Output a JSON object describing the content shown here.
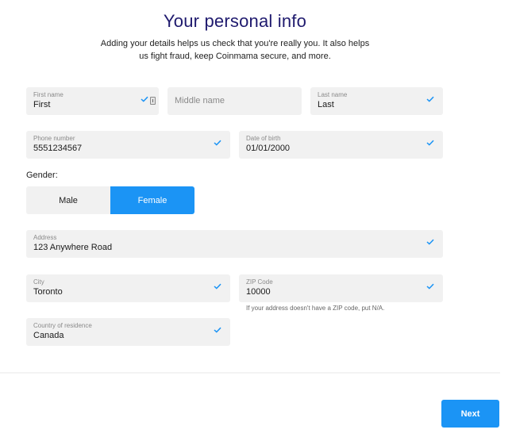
{
  "header": {
    "title": "Your personal info",
    "subtitle": "Adding your details helps us check that you're really you. It also helps us fight fraud, keep Coinmama secure, and more."
  },
  "fields": {
    "first_name": {
      "label": "First name",
      "value": "First",
      "valid": true
    },
    "middle_name": {
      "placeholder": "Middle name",
      "value": ""
    },
    "last_name": {
      "label": "Last name",
      "value": "Last",
      "valid": true
    },
    "phone": {
      "label": "Phone number",
      "value": "5551234567",
      "valid": true
    },
    "dob": {
      "label": "Date of birth",
      "value": "01/01/2000",
      "valid": true
    },
    "address": {
      "label": "Address",
      "value": "123 Anywhere Road",
      "valid": true
    },
    "city": {
      "label": "City",
      "value": "Toronto",
      "valid": true
    },
    "zip": {
      "label": "ZIP Code",
      "value": "10000",
      "valid": true,
      "hint": "If your address doesn't have a ZIP code, put N/A."
    },
    "country": {
      "label": "Country of residence",
      "value": "Canada",
      "valid": true
    }
  },
  "gender": {
    "label": "Gender:",
    "options": [
      "Male",
      "Female"
    ],
    "selected": "Female"
  },
  "footer": {
    "next_label": "Next"
  },
  "colors": {
    "accent": "#1b94f5",
    "title": "#1f1a6e",
    "field_bg": "#f1f1f1"
  },
  "icons": {
    "valid": "check-icon",
    "autofill": "keyboard-autofill-icon"
  }
}
